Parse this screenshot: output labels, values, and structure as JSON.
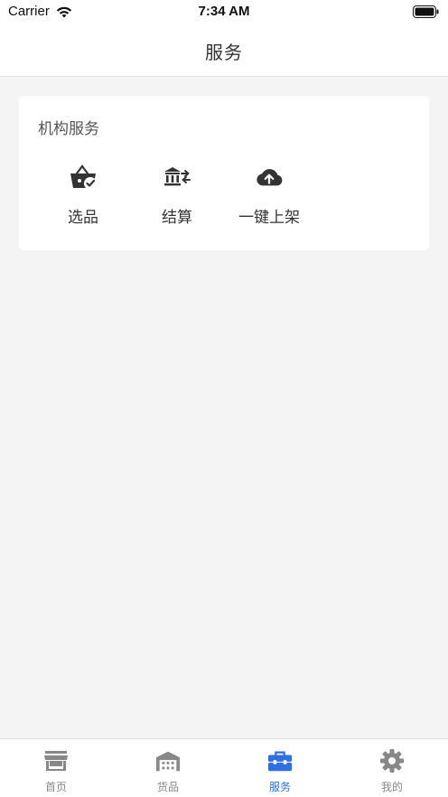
{
  "status_bar": {
    "carrier": "Carrier",
    "time": "7:34 AM"
  },
  "nav": {
    "title": "服务"
  },
  "section": {
    "title": "机构服务",
    "items": [
      {
        "label": "选品",
        "icon": "basket-check-icon"
      },
      {
        "label": "结算",
        "icon": "bank-transfer-icon"
      },
      {
        "label": "一键上架",
        "icon": "cloud-upload-icon"
      }
    ]
  },
  "tabs": [
    {
      "label": "首页",
      "icon": "store-icon",
      "active": false
    },
    {
      "label": "货品",
      "icon": "warehouse-icon",
      "active": false
    },
    {
      "label": "服务",
      "icon": "toolbox-icon",
      "active": true
    },
    {
      "label": "我的",
      "icon": "gear-icon",
      "active": false
    }
  ],
  "colors": {
    "accent": "#2f6fe4",
    "inactive": "#888888",
    "icon_dark": "#333333",
    "background": "#f4f4f4"
  }
}
